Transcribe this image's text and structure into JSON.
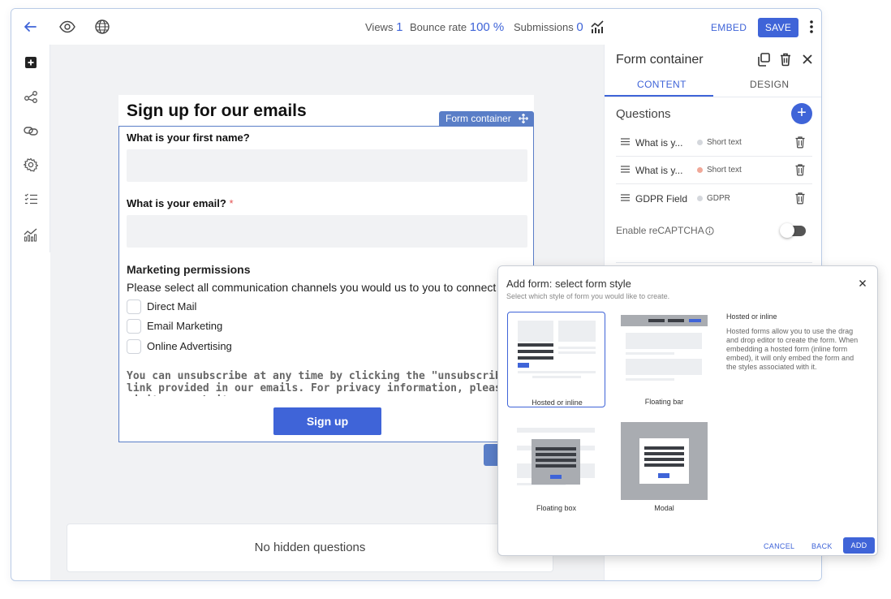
{
  "topbar": {
    "stats": {
      "views_label": "Views",
      "views_value": "1",
      "bounce_label": "Bounce rate",
      "bounce_value": "100 %",
      "submissions_label": "Submissions",
      "submissions_value": "0"
    },
    "embed_label": "EMBED",
    "save_label": "SAVE",
    "icons": [
      "back-arrow-icon",
      "eye-icon",
      "globe-icon",
      "analytics-icon",
      "kebab-menu-icon"
    ]
  },
  "leftbar": {
    "icons": [
      "add-block-icon",
      "share-icon",
      "link-icon",
      "settings-gear-icon",
      "checklist-icon",
      "analytics-icon"
    ]
  },
  "form": {
    "title": "Sign up for our emails",
    "container_tag": "Form container",
    "questions": [
      {
        "label": "What is your first name?",
        "required": false
      },
      {
        "label": "What is your email?",
        "required": true,
        "required_mark": "*"
      }
    ],
    "marketing": {
      "title": "Marketing permissions",
      "description": "Please select all communication channels you would us to you to connect with y",
      "options": [
        "Direct Mail",
        "Email Marketing",
        "Online Advertising"
      ]
    },
    "unsubscribe_text": "You can unsubscribe at any time by clicking the \"unsubscribe\" link provided in our emails. For privacy information, please visit our website.",
    "submit_label": "Sign up"
  },
  "hidden_questions": "No hidden questions",
  "panel": {
    "title": "Form container",
    "tabs": [
      {
        "label": "CONTENT",
        "active": true
      },
      {
        "label": "DESIGN",
        "active": false
      }
    ],
    "questions_heading": "Questions",
    "add_symbol": "+",
    "questions": [
      {
        "name": "What is y...",
        "type": "Short text",
        "dot_color": "#d4d7dc"
      },
      {
        "name": "What is y...",
        "type": "Short text",
        "dot_color": "#f0a898"
      },
      {
        "name": "GDPR Field",
        "type": "GDPR",
        "dot_color": "#d4d7dc"
      }
    ],
    "recaptcha_label": "Enable reCAPTCHA",
    "recaptcha_enabled": false
  },
  "modal": {
    "title": "Add form: select form style",
    "subtitle": "Select which style of form you would like to create.",
    "styles": [
      {
        "label": "Hosted or inline",
        "selected": true
      },
      {
        "label": "Floating bar",
        "selected": false
      },
      {
        "label": "Floating box",
        "selected": false
      },
      {
        "label": "Modal",
        "selected": false
      }
    ],
    "info_title": "Hosted or inline",
    "info_body": "Hosted forms allow you to use the drag and drop editor to create the form. When embedding a hosted form (inline form embed), it will only embed the form and the styles associated with it.",
    "cancel_label": "CANCEL",
    "back_label": "BACK",
    "add_label": "ADD"
  },
  "colors": {
    "accent": "#3f64d8",
    "container_blue": "#5a7ec7",
    "canvas_bg": "#f1f2f4",
    "required_red": "#e45252"
  }
}
